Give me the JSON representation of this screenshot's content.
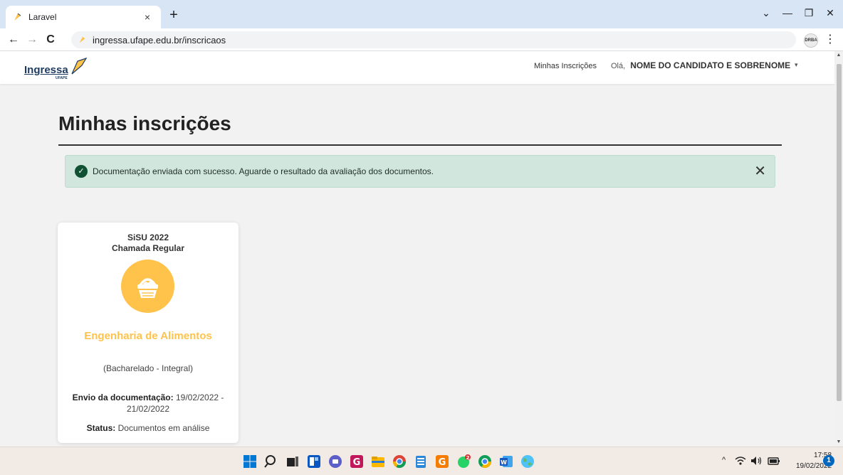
{
  "browser": {
    "tab_title": "Laravel",
    "tab_close": "×",
    "new_tab": "+",
    "url": "ingressa.ufape.edu.br/inscricaos",
    "profile_badge": "DRBA",
    "back": "←",
    "forward": "→",
    "reload": "C",
    "menu": "⋮",
    "minimize": "—",
    "restore": "❐",
    "close": "✕",
    "tab_search": "⌄"
  },
  "site": {
    "logo_text": "Ingressa",
    "logo_sub": "UFAPE",
    "nav_link": "Minhas Inscrições",
    "greeting": "Olá,",
    "user_name": "NOME DO CANDIDATO E SOBRENOME",
    "user_caret": "▾"
  },
  "main": {
    "title": "Minhas inscrições",
    "alert": {
      "message": "Documentação enviada com sucesso. Aguarde o resultado da avaliação dos documentos.",
      "check": "✓",
      "close": "✕",
      "color": "#d1e7dd"
    },
    "card": {
      "program": "SiSU 2022",
      "call": "Chamada Regular",
      "course": "Engenharia de Alimentos",
      "degree": "(Bacharelado - Integral)",
      "envio_label": "Envio da documentação:",
      "envio_value": "19/02/2022 - 21/02/2022",
      "status_label": "Status:",
      "status_value": "Documentos em análise",
      "accent_color": "#ffc24b",
      "icon": "basket-icon"
    }
  },
  "taskbar": {
    "time": "17:58",
    "date": "19/02/2022",
    "notifications": "1",
    "whatsapp_badge": "2",
    "tray_chevron": "^"
  }
}
